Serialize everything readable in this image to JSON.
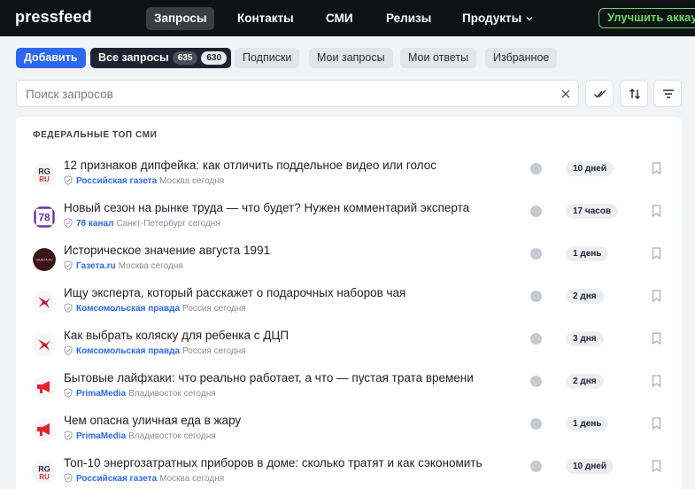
{
  "nav": {
    "logo": "pressfeed",
    "items": [
      "Запросы",
      "Контакты",
      "СМИ",
      "Релизы",
      "Продукты"
    ],
    "upgrade": "Улучшить аккаунт"
  },
  "tabs": {
    "add": "Добавить",
    "all": "Все запросы",
    "all_count": "635",
    "all_count2": "630",
    "subscriptions": "Подписки",
    "my_requests": "Мои запросы",
    "my_answers": "Мои ответы",
    "favorites": "Избранное"
  },
  "search": {
    "placeholder": "Поиск запросов"
  },
  "section": "ФЕДЕРАЛЬНЫЕ ТОП СМИ",
  "rows": [
    {
      "title": "12 признаков дипфейка: как отличить поддельное видео или голос",
      "source": "Российская газета",
      "location": "Москва сегодня",
      "time": "10 дней",
      "logo": "rg"
    },
    {
      "title": "Новый сезон на рынке труда — что будет? Нужен комментарий эксперта",
      "source": "78 канал",
      "location": "Санкт-Петербург сегодня",
      "time": "17 часов",
      "logo": "78"
    },
    {
      "title": "Историческое значение августа 1991",
      "source": "Газета.ru",
      "location": "Москва сегодня",
      "time": "1 день",
      "logo": "gazeta"
    },
    {
      "title": "Ищу эксперта, который расскажет о подарочных наборов чая",
      "source": "Комсомольская правда",
      "location": "Россия сегодня",
      "time": "2 дня",
      "logo": "kp"
    },
    {
      "title": "Как выбрать коляску для ребенка с ДЦП",
      "source": "Комсомольская правда",
      "location": "Россия сегодня",
      "time": "3 дня",
      "logo": "kp"
    },
    {
      "title": "Бытовые лайфхаки: что реально работает, а что — пустая трата времени",
      "source": "PrimaMedia",
      "location": "Владивосток сегодня",
      "time": "2 дня",
      "logo": "prima"
    },
    {
      "title": "Чем опасна уличная еда в жару",
      "source": "PrimaMedia",
      "location": "Владивосток сегодня",
      "time": "1 день",
      "logo": "prima"
    },
    {
      "title": "Топ-10 энергозатратных приборов в доме: сколько тратят и как сэкономить",
      "source": "Российская газета",
      "location": "Москва сегодня",
      "time": "10 дней",
      "logo": "rg"
    }
  ],
  "logo_text": {
    "rg_top": "RG",
    "rg_bottom": "RU",
    "ch78": "78",
    "gazeta": "GAZETA.RU"
  },
  "colors": {
    "accent": "#2d67f0",
    "upgrade": "#62dc62",
    "topbar": "#101114"
  }
}
